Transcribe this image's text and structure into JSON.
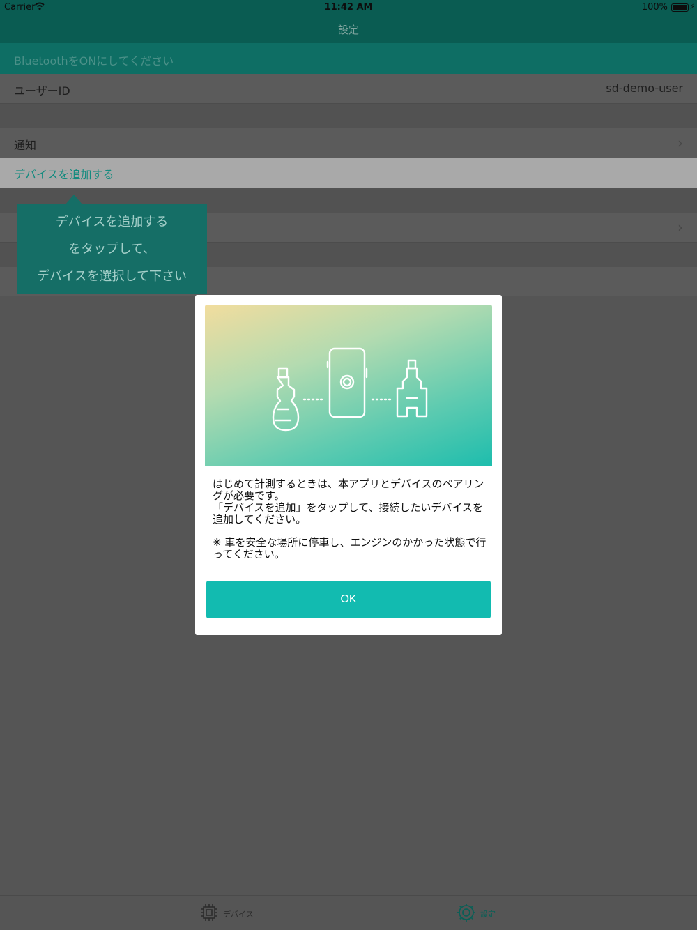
{
  "status_bar": {
    "carrier": "Carrier",
    "time": "11:42 AM",
    "battery": "100%"
  },
  "nav": {
    "title": "設定"
  },
  "banner": {
    "text": "BluetoothをONにしてください"
  },
  "settings": {
    "user_id_label": "ユーザーID",
    "user_id_value": "sd-demo-user",
    "notification_label": "通知",
    "add_device_label": "デバイスを追加する"
  },
  "tooltip": {
    "line1": "デバイスを追加する",
    "line2": "をタップして、",
    "line3": "デバイスを選択して下さい"
  },
  "modal": {
    "paragraph1": "はじめて計測するときは、本アプリとデバイスのペアリングが必要です。\n「デバイスを追加」をタップして、接続したいデバイスを追加してください。",
    "paragraph2": "※ 車を安全な場所に停車し、エンジンのかかった状態で行ってください。",
    "ok_label": "OK"
  },
  "tabs": [
    {
      "label": "デバイス",
      "icon": "chip-icon"
    },
    {
      "label": "設定",
      "icon": "gear-icon"
    }
  ],
  "colors": {
    "accent": "#12bbb0",
    "nav_dimmed": "#0a5c52"
  }
}
